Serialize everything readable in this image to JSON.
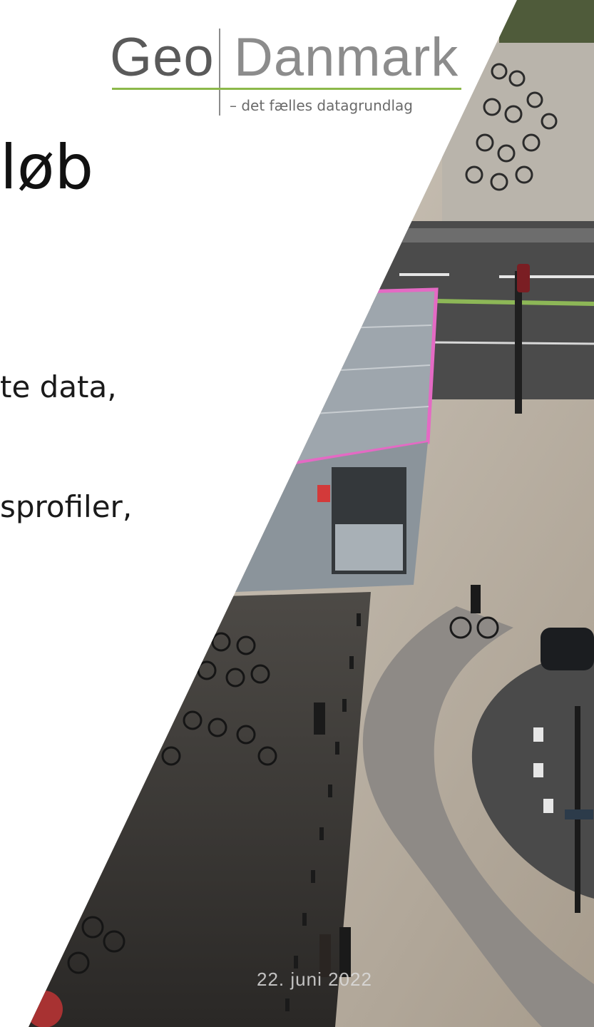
{
  "logo": {
    "word_geo": "Geo",
    "word_danmark": "Danmark",
    "tagline": "– det fælles datagrundlag",
    "accent_color": "#8cb84a"
  },
  "slide": {
    "title_fragment": "løb",
    "bullet_1_fragment": "te data,",
    "bullet_2_fragment": "sprofiler,",
    "footer_date": "22. juni 2022"
  },
  "photo": {
    "subject": "aerial-street-photo-with-cyclists-and-bike-parking",
    "highlight_color": "#e46ac4"
  }
}
